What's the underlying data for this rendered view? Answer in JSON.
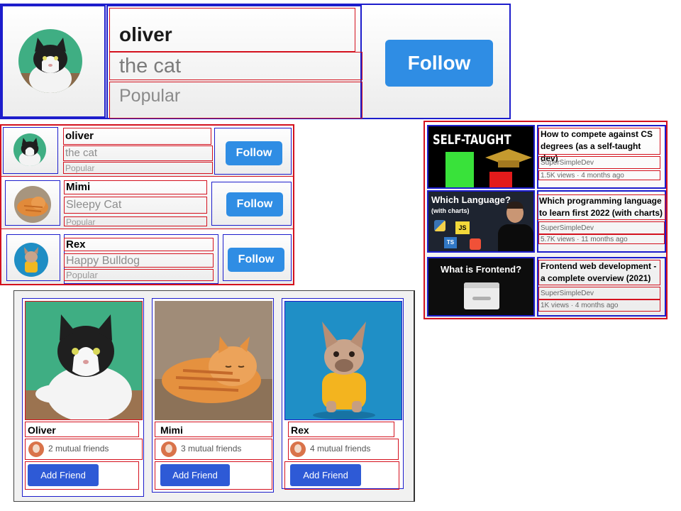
{
  "big_card": {
    "name": "oliver",
    "subtitle": "the cat",
    "tag": "Popular",
    "follow_label": "Follow"
  },
  "follow_list": [
    {
      "name": "oliver",
      "subtitle": "the cat",
      "tag": "Popular",
      "follow_label": "Follow"
    },
    {
      "name": "Mimi",
      "subtitle": "Sleepy Cat",
      "tag": "Popular",
      "follow_label": "Follow"
    },
    {
      "name": "Rex",
      "subtitle": "Happy Bulldog",
      "tag": "Popular",
      "follow_label": "Follow"
    }
  ],
  "videos": [
    {
      "thumb_text": "SELF-TAUGHT",
      "title": "How to compete against CS degrees (as a self-taught dev)",
      "channel": "SuperSimpleDev",
      "stats": "1.5K views · 4 months ago"
    },
    {
      "thumb_text": "Which Language?",
      "thumb_sub": "(with charts)",
      "title": "Which programming language to learn first 2022 (with charts)",
      "channel": "SuperSimpleDev",
      "stats": "5.7K views · 11 months ago",
      "badges": [
        "JS",
        "TS"
      ]
    },
    {
      "thumb_text": "What is Frontend?",
      "title": "Frontend web development - a complete overview (2021)",
      "channel": "SuperSimpleDev",
      "stats": "1K views · 4 months ago"
    }
  ],
  "friends": [
    {
      "name": "Oliver",
      "mutual": "2 mutual friends",
      "button": "Add Friend"
    },
    {
      "name": "Mimi",
      "mutual": "3 mutual friends",
      "button": "Add Friend"
    },
    {
      "name": "Rex",
      "mutual": "4 mutual friends",
      "button": "Add Friend"
    }
  ],
  "colors": {
    "follow_blue": "#2f8de4",
    "add_friend_blue": "#2e5ad6",
    "outline_blue": "#1d1dcc",
    "outline_red": "#d4111e"
  }
}
